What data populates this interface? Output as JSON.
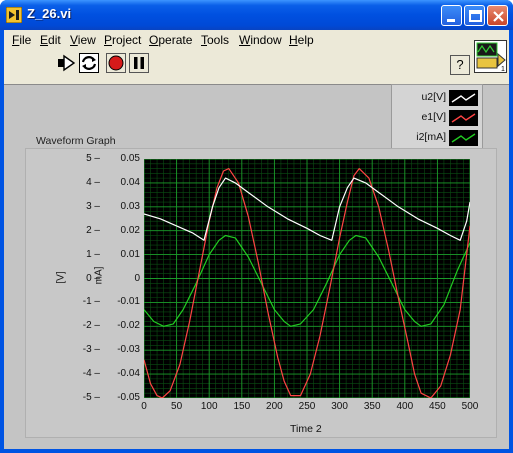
{
  "window": {
    "title": "Z_26.vi"
  },
  "menu": [
    {
      "label": "File",
      "u": "F",
      "rest": "ile"
    },
    {
      "label": "Edit",
      "u": "E",
      "rest": "dit"
    },
    {
      "label": "View",
      "u": "V",
      "rest": "iew"
    },
    {
      "label": "Project",
      "u": "P",
      "rest": "roject"
    },
    {
      "label": "Operate",
      "u": "O",
      "rest": "perate"
    },
    {
      "label": "Tools",
      "u": "T",
      "rest": "ools"
    },
    {
      "label": "Window",
      "u": "W",
      "rest": "indow"
    },
    {
      "label": "Help",
      "u": "H",
      "rest": "elp"
    }
  ],
  "toolbar": {
    "help_label": "?",
    "connector_label": "1"
  },
  "graph": {
    "label": "Waveform Graph",
    "xlabel": "Time 2",
    "ylabel_left": "[V]",
    "ylabel_right": "mA]",
    "x_ticks": [
      "0",
      "50",
      "100",
      "150",
      "200",
      "250",
      "300",
      "350",
      "400",
      "450",
      "500"
    ],
    "y_left_ticks": [
      "5",
      "4",
      "3",
      "2",
      "1",
      "0",
      "-1",
      "-2",
      "-3",
      "-4",
      "-5"
    ],
    "y_right_ticks": [
      "0.05",
      "0.04",
      "0.03",
      "0.02",
      "0.01",
      "0",
      "-0.01",
      "-0.02",
      "-0.03",
      "-0.04",
      "-0.05"
    ]
  },
  "legend": [
    {
      "name": "u2[V]",
      "color": "#ffffff"
    },
    {
      "name": "e1[V]",
      "color": "#ff4444"
    },
    {
      "name": "i2[mA]",
      "color": "#22cc22"
    }
  ],
  "chart_data": {
    "type": "line",
    "xlabel": "Time 2",
    "xlim": [
      0,
      500
    ],
    "ylim": [
      -0.05,
      0.05
    ],
    "grid": true,
    "legend_position": "top-right",
    "series": [
      {
        "name": "u2[V]",
        "color": "#ffffff",
        "x": [
          0,
          25,
          50,
          75,
          92,
          105,
          115,
          125,
          140,
          160,
          190,
          220,
          250,
          270,
          288,
          300,
          312,
          322,
          340,
          360,
          390,
          420,
          450,
          470,
          485,
          495,
          500
        ],
        "y": [
          0.027,
          0.025,
          0.022,
          0.019,
          0.016,
          0.03,
          0.038,
          0.042,
          0.04,
          0.036,
          0.03,
          0.025,
          0.021,
          0.018,
          0.016,
          0.03,
          0.038,
          0.042,
          0.04,
          0.036,
          0.03,
          0.025,
          0.021,
          0.018,
          0.016,
          0.024,
          0.032
        ]
      },
      {
        "name": "e1[V]",
        "color": "#ff4444",
        "x": [
          0,
          10,
          20,
          28,
          40,
          55,
          70,
          85,
          100,
          112,
          122,
          130,
          145,
          160,
          175,
          190,
          205,
          215,
          225,
          240,
          255,
          270,
          285,
          300,
          312,
          322,
          330,
          345,
          360,
          375,
          390,
          405,
          415,
          425,
          440,
          455,
          470,
          485,
          500
        ],
        "y": [
          -0.034,
          -0.044,
          -0.049,
          -0.05,
          -0.047,
          -0.036,
          -0.018,
          0.003,
          0.024,
          0.038,
          0.045,
          0.046,
          0.04,
          0.026,
          0.007,
          -0.014,
          -0.033,
          -0.043,
          -0.049,
          -0.049,
          -0.04,
          -0.024,
          -0.004,
          0.017,
          0.032,
          0.043,
          0.046,
          0.042,
          0.03,
          0.012,
          -0.008,
          -0.027,
          -0.04,
          -0.048,
          -0.05,
          -0.045,
          -0.032,
          -0.013,
          0.022
        ]
      },
      {
        "name": "i2[mA]",
        "color": "#22cc22",
        "x": [
          0,
          15,
          30,
          45,
          60,
          80,
          100,
          115,
          125,
          140,
          160,
          180,
          200,
          215,
          225,
          240,
          260,
          280,
          300,
          315,
          325,
          340,
          360,
          380,
          400,
          415,
          425,
          440,
          460,
          480,
          500
        ],
        "y": [
          -0.013,
          -0.018,
          -0.02,
          -0.019,
          -0.013,
          -0.002,
          0.01,
          0.016,
          0.018,
          0.017,
          0.009,
          -0.002,
          -0.013,
          -0.018,
          -0.02,
          -0.019,
          -0.013,
          -0.002,
          0.01,
          0.016,
          0.018,
          0.017,
          0.009,
          -0.002,
          -0.013,
          -0.018,
          -0.02,
          -0.019,
          -0.011,
          0.003,
          0.015
        ]
      }
    ]
  }
}
